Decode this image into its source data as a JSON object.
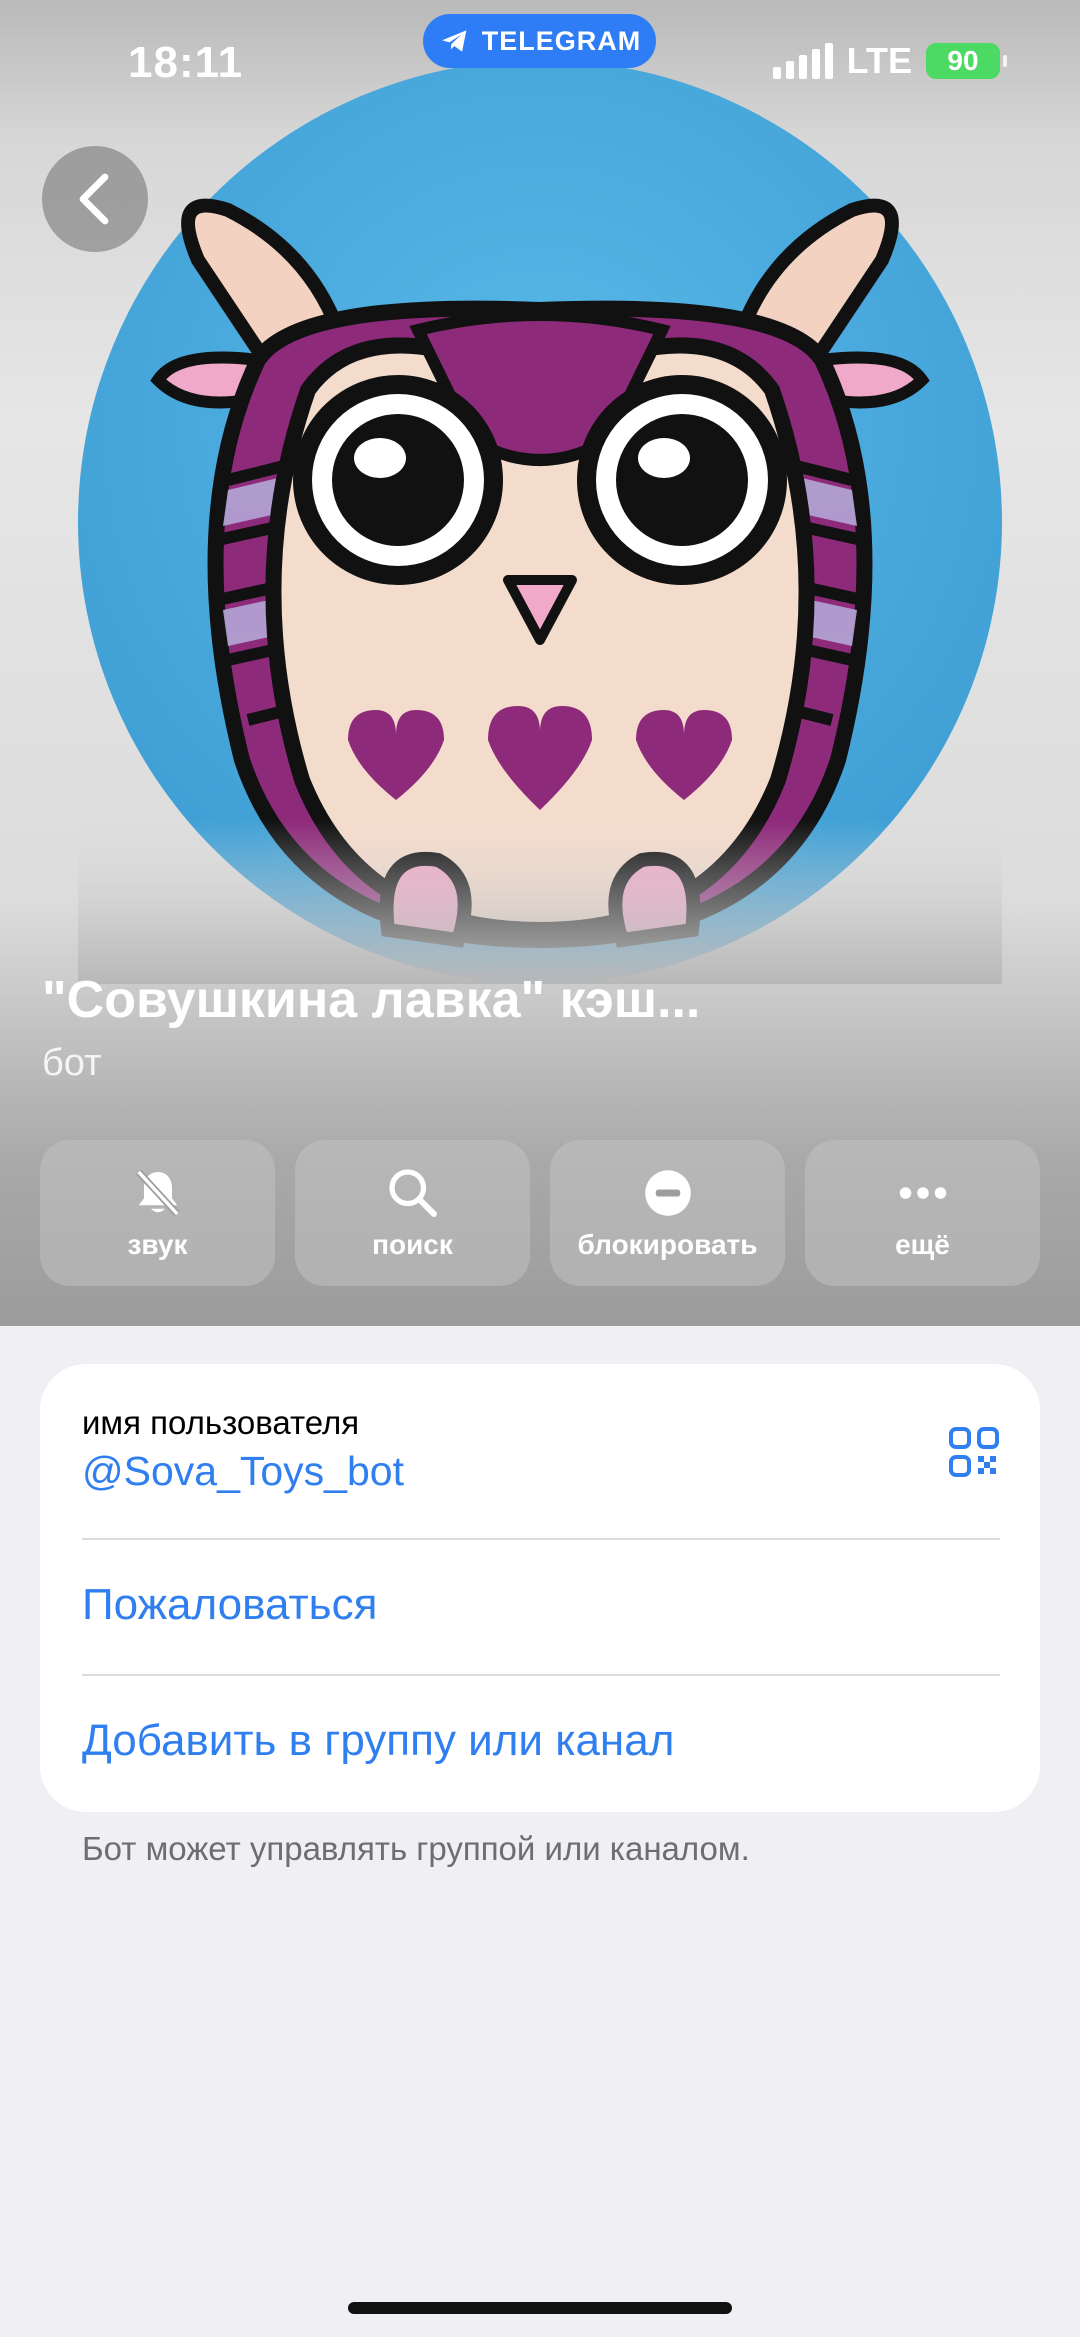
{
  "status_bar": {
    "time": "18:11",
    "app_pill": "TELEGRAM",
    "network": "LTE",
    "battery": "90"
  },
  "profile": {
    "title": "\"Совушкина лавка\" кэш...",
    "subtitle": "бот",
    "avatar_icon": "owl-avatar"
  },
  "actions": [
    {
      "label": "звук",
      "icon": "bell-slash-icon"
    },
    {
      "label": "поиск",
      "icon": "search-icon"
    },
    {
      "label": "блокировать",
      "icon": "block-icon"
    },
    {
      "label": "ещё",
      "icon": "more-icon"
    }
  ],
  "info": {
    "username_label": "имя пользователя",
    "username_value": "@Sova_Toys_bot",
    "report_label": "Пожаловаться",
    "add_label": "Добавить в группу или канал",
    "footnote": "Бот может управлять группой или каналом."
  },
  "colors": {
    "accent": "#2f7ff0",
    "pill": "#2f7df6",
    "battery": "#4cd964",
    "avatar_bg": "#4fb0e2",
    "owl_purple": "#8e2a7a"
  }
}
